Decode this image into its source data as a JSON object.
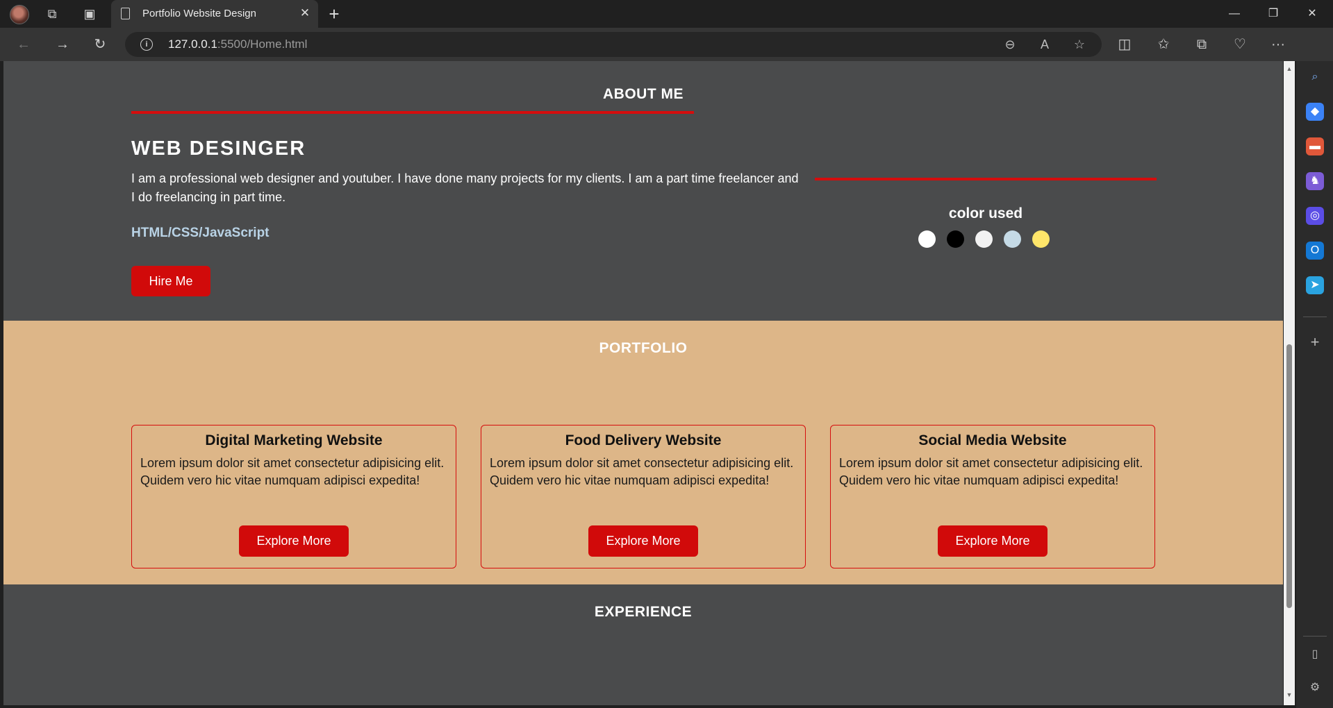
{
  "browser": {
    "tab_title": "Portfolio Website Design",
    "url_host": "127.0.0.1",
    "url_rest": ":5500/Home.html",
    "close_tab_glyph": "✕",
    "new_tab_glyph": "+"
  },
  "about": {
    "heading": "ABOUT ME",
    "job_title": "WEB DESINGER",
    "description": "I am a professional web designer and youtuber. I have done many projects for my clients. I am a part time freelancer and I do freelancing in part time.",
    "skills": "HTML/CSS/JavaScript",
    "hire_label": "Hire Me",
    "color_label": "color used",
    "colors": [
      "#ffffff",
      "#000000",
      "#f2f2f2",
      "#c5dae6",
      "#ffe66a"
    ],
    "accent": "#d50d0d"
  },
  "portfolio": {
    "heading": "PORTFOLIO",
    "background": "#ddb688",
    "cards": [
      {
        "title": "Digital Marketing Website",
        "text": "Lorem ipsum dolor sit amet consectetur adipisicing elit. Quidem vero hic vitae numquam adipisci expedita!",
        "button": "Explore More"
      },
      {
        "title": "Food Delivery Website",
        "text": "Lorem ipsum dolor sit amet consectetur adipisicing elit. Quidem vero hic vitae numquam adipisci expedita!",
        "button": "Explore More"
      },
      {
        "title": "Social Media Website",
        "text": "Lorem ipsum dolor sit amet consectetur adipisicing elit. Quidem vero hic vitae numquam adipisci expedita!",
        "button": "Explore More"
      }
    ]
  },
  "experience": {
    "heading": "EXPERIENCE"
  }
}
